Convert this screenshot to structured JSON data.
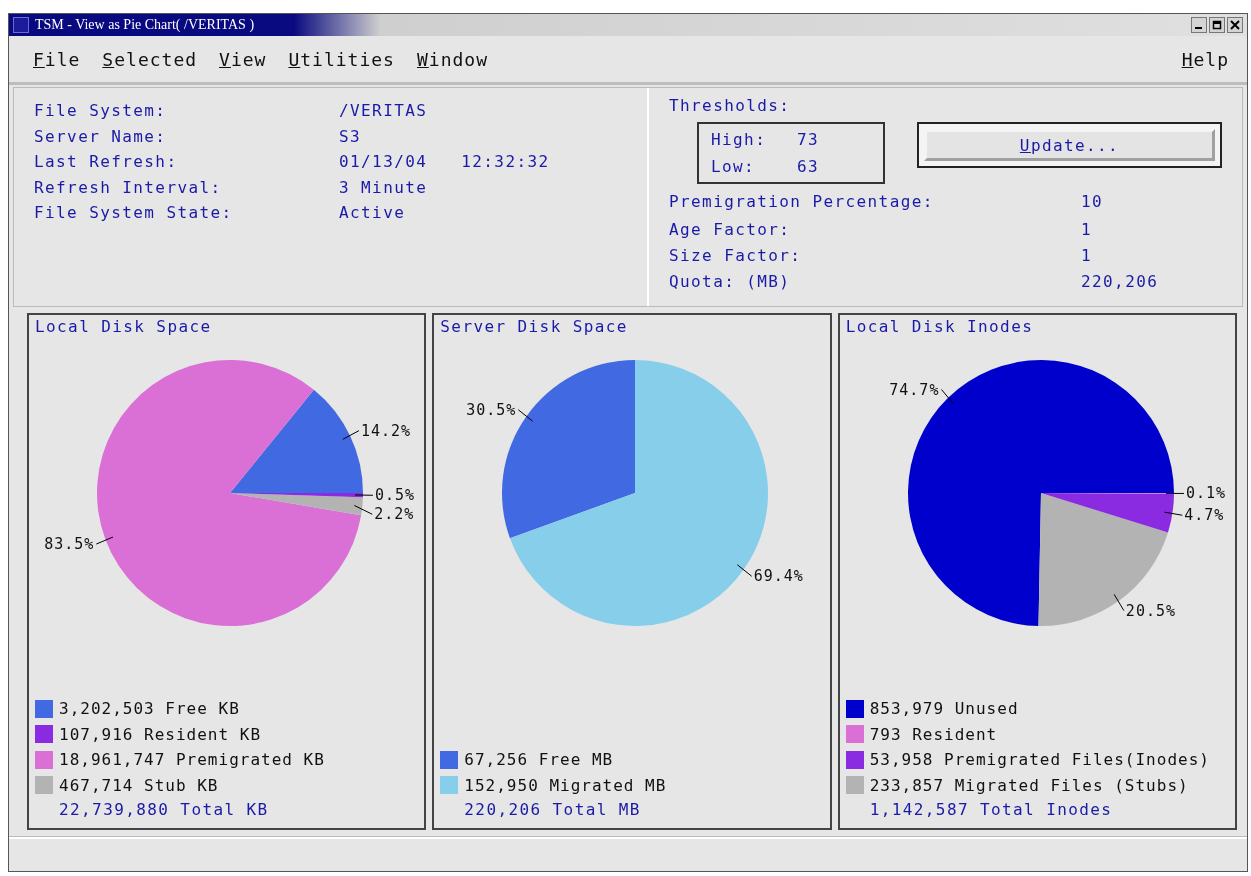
{
  "window": {
    "title": "TSM - View as Pie Chart( /VERITAS )"
  },
  "menu": [
    "File",
    "Selected",
    "View",
    "Utilities",
    "Window"
  ],
  "help_menu": "Help",
  "info": [
    {
      "label": "File System:",
      "value": "/VERITAS"
    },
    {
      "label": "Server Name:",
      "value": "S3"
    },
    {
      "label": "Last Refresh:",
      "value": "01/13/04",
      "value_2": "12:32:32"
    },
    {
      "label": "Refresh Interval:",
      "value": "3 Minute"
    },
    {
      "label": "File System State:",
      "value": "Active"
    }
  ],
  "thresholds": {
    "label": "Thresholds:",
    "high_label": "High:",
    "high": "73",
    "low_label": "Low:",
    "low": "63"
  },
  "update_button": "Update...",
  "settings": [
    {
      "label": "Premigration Percentage:",
      "value": "10"
    },
    {
      "label": "Age Factor:",
      "value": "1"
    },
    {
      "label": "Size Factor:",
      "value": "1"
    },
    {
      "label": "Quota: (MB)",
      "value": "220,206"
    }
  ],
  "panels": [
    {
      "title": "Local Disk Space",
      "legend": [
        {
          "text": "3,202,503 Free KB",
          "color": "#4169e1"
        },
        {
          "text": "107,916 Resident KB",
          "color": "#8a2be2"
        },
        {
          "text": "18,961,747 Premigrated KB",
          "color": "#da70d6"
        },
        {
          "text": "467,714 Stub KB",
          "color": "#b3b3b3"
        }
      ],
      "total": "22,739,880 Total KB",
      "chart_data": {
        "type": "pie",
        "values": [
          14.2,
          83.5,
          2.2,
          0.5
        ],
        "colors": [
          "#4169e1",
          "#da70d6",
          "#b3b3b3",
          "#8a2be2"
        ],
        "value_labels": [
          "14.2%",
          "83.5%",
          "2.2%",
          "0.5%"
        ]
      }
    },
    {
      "title": "Server Disk Space",
      "legend": [
        {
          "text": "67,256 Free MB",
          "color": "#4169e1"
        },
        {
          "text": "152,950 Migrated MB",
          "color": "#87ceeb"
        }
      ],
      "total": "220,206 Total MB",
      "chart_data": {
        "type": "pie",
        "values": [
          30.5,
          69.4
        ],
        "colors": [
          "#4169e1",
          "#87ceeb"
        ],
        "value_labels": [
          "30.5%",
          "69.4%"
        ]
      }
    },
    {
      "title": "Local Disk Inodes",
      "legend": [
        {
          "text": "853,979 Unused",
          "color": "#0000cd"
        },
        {
          "text": "793 Resident",
          "color": "#da70d6"
        },
        {
          "text": "53,958 Premigrated Files(Inodes)",
          "color": "#8a2be2"
        },
        {
          "text": "233,857 Migrated Files (Stubs)",
          "color": "#b3b3b3"
        }
      ],
      "total": "1,142,587 Total Inodes",
      "chart_data": {
        "type": "pie",
        "values": [
          74.7,
          20.5,
          4.7,
          0.1
        ],
        "colors": [
          "#0000cd",
          "#b3b3b3",
          "#8a2be2",
          "#da70d6"
        ],
        "value_labels": [
          "74.7%",
          "20.5%",
          "4.7%",
          "0.1%"
        ]
      }
    }
  ]
}
